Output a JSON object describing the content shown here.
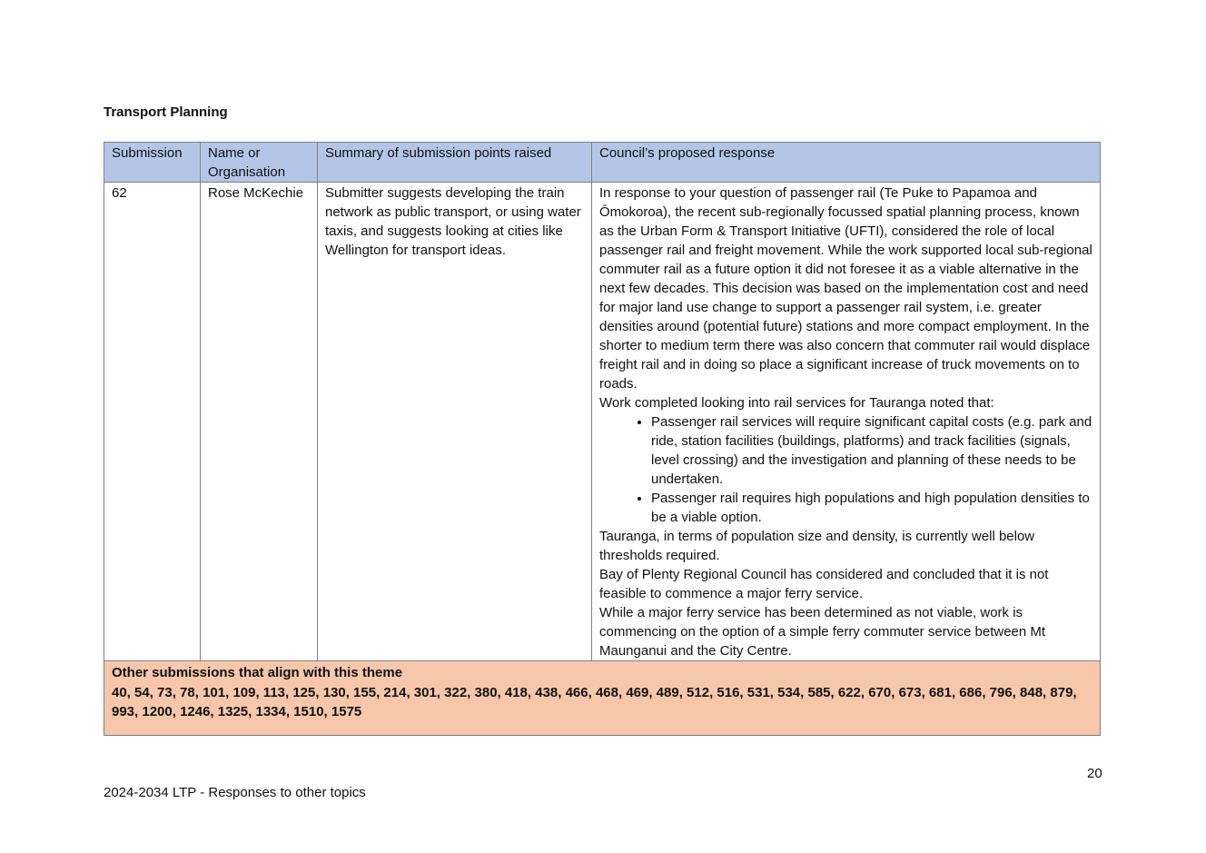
{
  "heading": "Transport Planning",
  "table": {
    "headers": [
      "Submission",
      "Name or Organisation",
      "Summary of submission points raised",
      "Council’s proposed response"
    ],
    "row": {
      "submission": "62",
      "name": "Rose McKechie",
      "summary": "Submitter suggests developing the train network as public transport, or using water taxis, and suggests looking at cities like Wellington for transport ideas.",
      "response": {
        "p1": "In response to your question of passenger rail (Te Puke to Papamoa and Ōmokoroa), the recent sub-regionally focussed spatial planning process, known as the Urban Form & Transport Initiative (UFTI), considered the role of local passenger rail and freight movement.  While the work supported local sub-regional commuter rail as a future option it did not foresee it as a viable alternative in the next few decades. This decision was based on the implementation cost and need for major land use change to support a passenger rail system, i.e. greater densities around (potential future) stations and more compact employment. In the shorter to medium term there was also concern that commuter rail would displace freight rail and in doing so place a significant increase of truck movements on to roads.",
        "p2": "Work completed looking into rail services for Tauranga noted that:",
        "bullets": [
          "Passenger rail services will require significant capital costs (e.g. park and ride, station facilities (buildings, platforms) and track facilities (signals, level crossing) and the investigation and planning of these needs to be undertaken.",
          "Passenger rail requires high populations and high population densities to be a viable option."
        ],
        "p3": "Tauranga, in terms of population size and density, is currently well below thresholds required.",
        "p4": "Bay of Plenty Regional Council has considered and concluded that it is not feasible to commence a major ferry service.",
        "p5": "While a major ferry service has been determined as not viable, work is commencing on the option of a simple ferry commuter service between Mt Maunganui and the City Centre."
      }
    },
    "other_title": "Other submissions that align with this theme",
    "other_list": "40, 54, 73, 78, 101, 109, 113, 125, 130, 155, 214, 301, 322, 380, 418, 438, 466, 468, 469, 489, 512, 516, 531, 534, 585, 622, 670, 673, 681, 686, 796, 848, 879, 993, 1200, 1246, 1325, 1334, 1510, 1575"
  },
  "page_number": "20",
  "footer": "2024-2034 LTP - Responses to other topics"
}
